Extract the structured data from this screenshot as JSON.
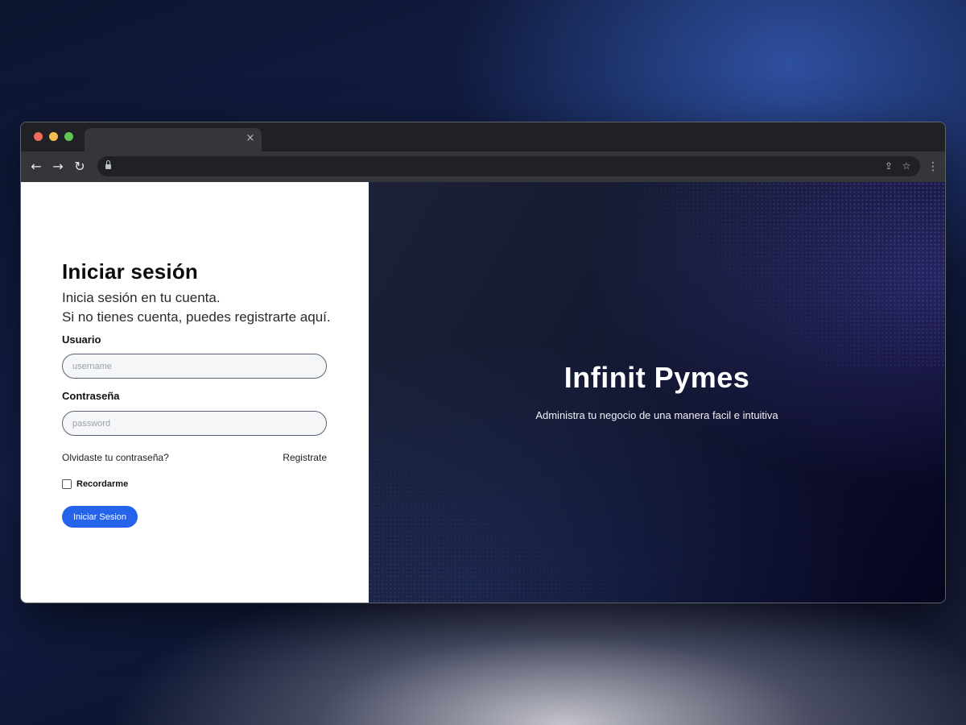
{
  "browser": {
    "tab_close_glyph": "×",
    "nav": {
      "back": "←",
      "forward": "→",
      "reload": "↻"
    },
    "omnibox_icons": [
      "lock-icon",
      "share-icon",
      "star-icon"
    ],
    "menu_glyph": "⋮"
  },
  "login": {
    "title": "Iniciar sesión",
    "subtitle_line1": "Inicia sesión en tu cuenta.",
    "subtitle_line2": "Si no tienes cuenta, puedes registrarte aquí.",
    "username_label": "Usuario",
    "username_placeholder": "username",
    "username_value": "",
    "password_label": "Contraseña",
    "password_placeholder": "password",
    "password_value": "",
    "forgot_link": "Olvidaste tu contraseña?",
    "register_link": "Registrate",
    "remember_label": "Recordarme",
    "remember_checked": false,
    "submit_label": "Iniciar Sesion",
    "accent_color": "#2563eb"
  },
  "brand": {
    "title": "Infinit Pymes",
    "tagline": "Administra tu negocio de una manera facil e intuitiva"
  }
}
